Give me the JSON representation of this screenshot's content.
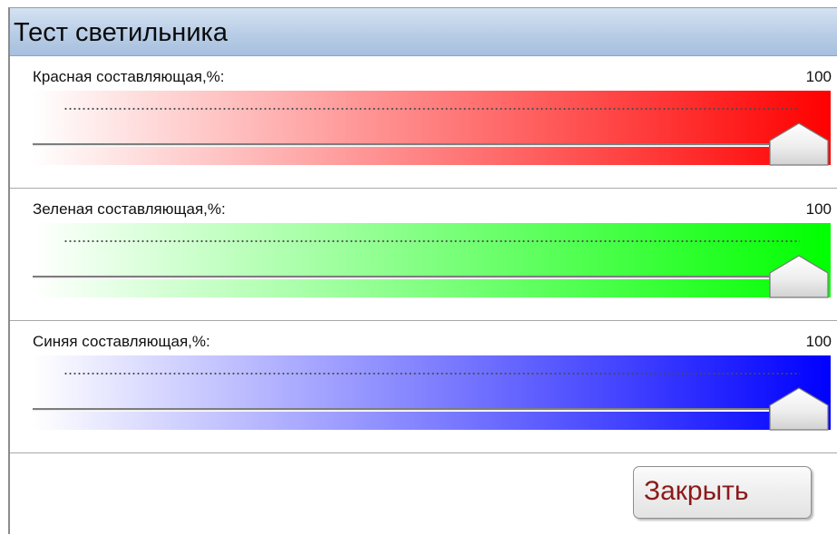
{
  "window": {
    "title": "Тест светильника"
  },
  "sliders": [
    {
      "label": "Красная составляющая,%:",
      "value": "100",
      "level": 1.0,
      "color": "#ff0000"
    },
    {
      "label": "Зеленая составляющая,%:",
      "value": "100",
      "level": 1.0,
      "color": "#00ff00"
    },
    {
      "label": "Синяя составляющая,%:",
      "value": "100",
      "level": 1.0,
      "color": "#0000ff"
    }
  ],
  "footer": {
    "close_label": "Закрыть"
  }
}
